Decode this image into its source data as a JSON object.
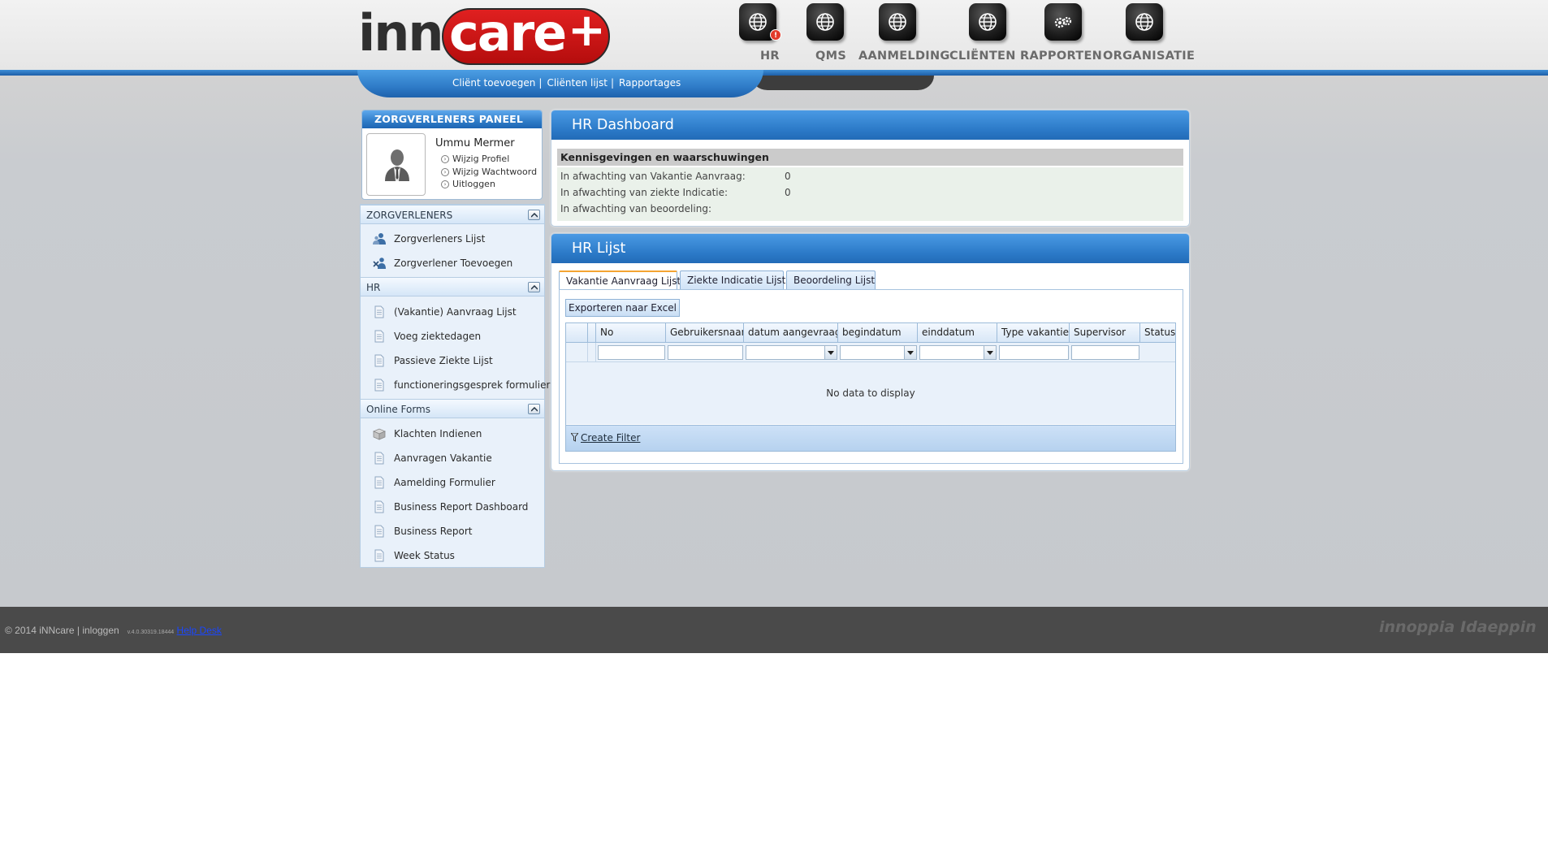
{
  "app": {
    "logo_text_inn": "inn",
    "logo_text_care": "care",
    "logo_text_plus": "+",
    "brand_red": "#d41616",
    "brand_blue": "#2f7cc8"
  },
  "topnav": [
    {
      "label": "HR",
      "icon": "globe-icon",
      "badge": "!"
    },
    {
      "label": "QMS",
      "icon": "globe-icon"
    },
    {
      "label": "AANMELDING",
      "icon": "globe-icon"
    },
    {
      "label": "CLIËNTEN",
      "icon": "globe-icon"
    },
    {
      "label": "RAPPORTEN",
      "icon": "gears-icon"
    },
    {
      "label": "ORGANISATIE",
      "icon": "globe-icon"
    }
  ],
  "subnav": {
    "links": [
      "Cliënt toevoegen",
      "Cliënten lijst",
      "Rapportages"
    ],
    "separator": "|"
  },
  "profile": {
    "panel_title": "ZORGVERLENERS PANEEL",
    "name": "Ummu Mermer",
    "links": [
      "Wijzig Profiel",
      "Wijzig Wachtwoord",
      "Uitloggen"
    ]
  },
  "sidebar": {
    "sections": [
      {
        "title": "ZORGVERLENERS",
        "items": [
          {
            "label": "Zorgverleners Lijst",
            "icon": "users-icon"
          },
          {
            "label": "Zorgverlener Toevoegen",
            "icon": "add-user-icon"
          }
        ]
      },
      {
        "title": "HR",
        "items": [
          {
            "label": "(Vakantie) Aanvraag Lijst",
            "icon": "document-icon"
          },
          {
            "label": "Voeg ziektedagen",
            "icon": "document-icon"
          },
          {
            "label": "Passieve Ziekte Lijst",
            "icon": "document-icon"
          },
          {
            "label": "functioneringsgesprek formulier",
            "icon": "document-icon"
          }
        ]
      },
      {
        "title": "Online Forms",
        "items": [
          {
            "label": "Klachten Indienen",
            "icon": "box-icon"
          },
          {
            "label": "Aanvragen Vakantie",
            "icon": "document-icon"
          },
          {
            "label": "Aamelding Formulier",
            "icon": "document-icon"
          },
          {
            "label": "Business Report Dashboard",
            "icon": "document-icon"
          },
          {
            "label": "Business Report",
            "icon": "document-icon"
          },
          {
            "label": "Week Status",
            "icon": "document-icon"
          }
        ]
      }
    ]
  },
  "dashboard": {
    "title": "HR Dashboard",
    "notices_title": "Kennisgevingen en waarschuwingen",
    "rows": [
      {
        "label": "In afwachting van Vakantie Aanvraag:",
        "value": "0"
      },
      {
        "label": "In afwachting van ziekte Indicatie:",
        "value": "0"
      },
      {
        "label": "In afwachting van beoordeling:",
        "value": ""
      }
    ]
  },
  "hr_list": {
    "title": "HR Lijst",
    "tabs": [
      "Vakantie Aanvraag Lijst",
      "Ziekte Indicatie Lijst",
      "Beoordeling Lijst"
    ],
    "active_tab": "Vakantie Aanvraag Lijst",
    "export_label": "Exporteren naar Excel",
    "columns": [
      "",
      "",
      "No",
      "Gebruikersnaam",
      "datum aangevraagd",
      "begindatum",
      "einddatum",
      "Type vakantie",
      "Supervisor",
      "Status"
    ],
    "empty_text": "No data to display",
    "create_filter_label": "Create Filter"
  },
  "footer": {
    "copyright": "© 2014 iNNcare | inloggen",
    "version": "v.4.0.30319.18444",
    "help_label": "Help Desk",
    "logos": [
      "innoppia",
      "Idaeppin"
    ]
  }
}
